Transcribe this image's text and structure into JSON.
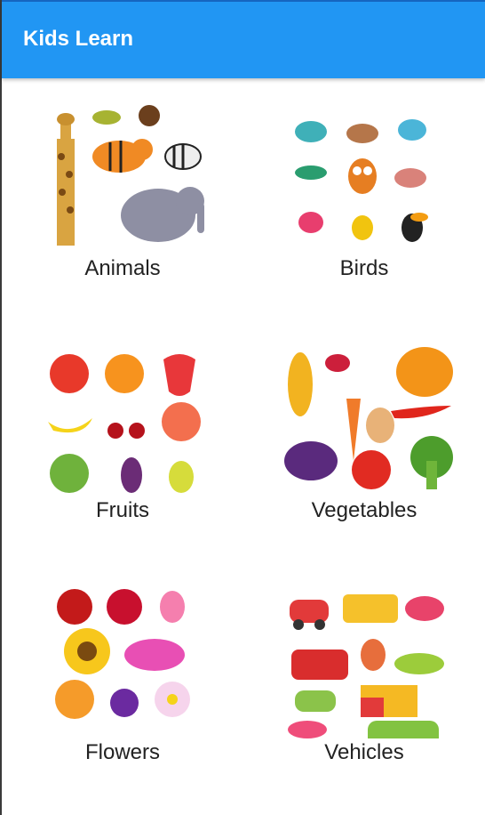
{
  "app": {
    "title": "Kids Learn"
  },
  "categories": [
    {
      "label": "Animals",
      "icon": "animals-collage"
    },
    {
      "label": "Birds",
      "icon": "birds-collage"
    },
    {
      "label": "Fruits",
      "icon": "fruits-collage"
    },
    {
      "label": "Vegetables",
      "icon": "vegetables-collage"
    },
    {
      "label": "Flowers",
      "icon": "flowers-collage"
    },
    {
      "label": "Vehicles",
      "icon": "vehicles-collage"
    }
  ],
  "colors": {
    "appbar": "#2196F3",
    "title_text": "#FFFFFF",
    "label_text": "#222222"
  }
}
